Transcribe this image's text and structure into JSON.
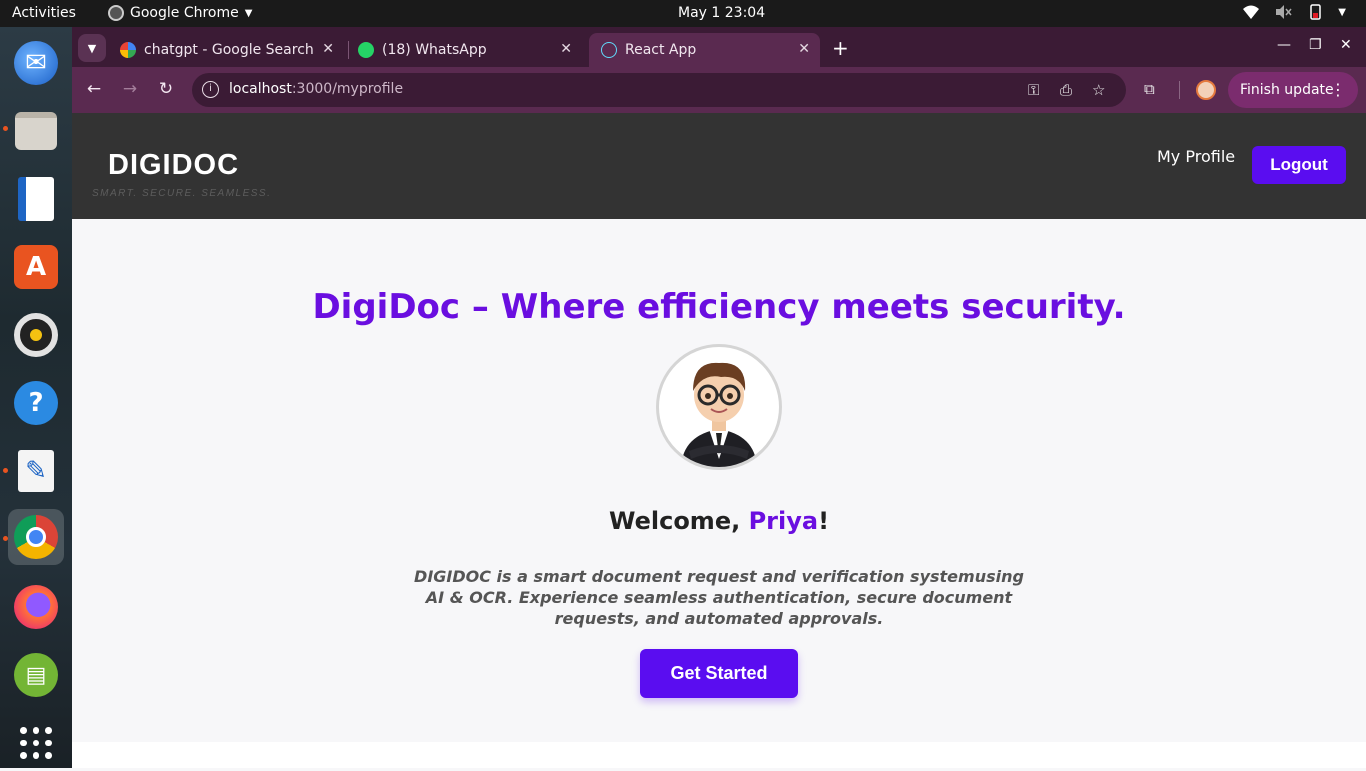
{
  "system_bar": {
    "activities": "Activities",
    "app_name": "Google Chrome",
    "datetime": "May 1  23:04"
  },
  "browser": {
    "tabs": [
      {
        "title": "chatgpt - Google Search",
        "active": false
      },
      {
        "title": "(18) WhatsApp",
        "active": false
      },
      {
        "title": "React App",
        "active": true
      }
    ],
    "url_host": "localhost",
    "url_path": ":3000/myprofile",
    "finish_update": "Finish update"
  },
  "site": {
    "brand": "DIGIDOC",
    "tagline": "SMART. SECURE. SEAMLESS.",
    "nav_profile": "My Profile",
    "logout": "Logout",
    "hero_title": "DigiDoc – Where efficiency meets security.",
    "welcome_prefix": "Welcome, ",
    "user_name": "Priya",
    "welcome_suffix": "!",
    "description": "DIGIDOC is a smart document request and verification systemusing AI & OCR. Experience seamless authentication, secure document requests, and automated approvals.",
    "cta": "Get Started"
  },
  "colors": {
    "accent": "#5a0df0",
    "title_purple": "#6a0ee0",
    "header_bg": "#333333",
    "chrome_frame": "#3b1b35",
    "chrome_toolbar": "#5a2a50"
  }
}
